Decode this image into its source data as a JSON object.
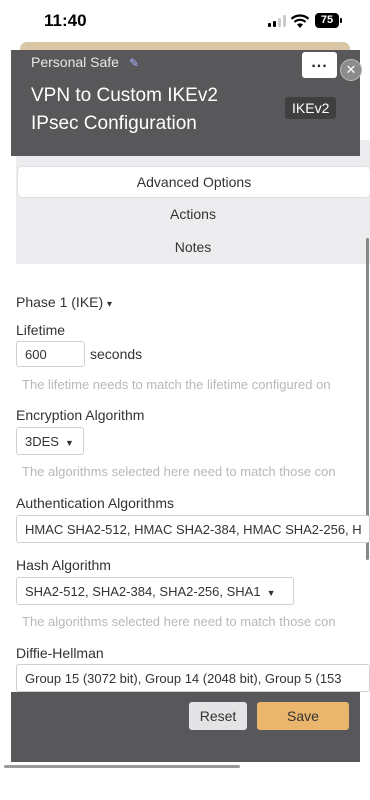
{
  "status_bar": {
    "time": "11:40",
    "battery": "75"
  },
  "header": {
    "section": "Personal Safe",
    "title_line1": "VPN to Custom IKEv2",
    "title_line2_bold": "IPsec",
    "title_line2_rest": " Configuration",
    "badge": "IKEv2",
    "more_label": "...",
    "close_label": "✕"
  },
  "tabs": [
    {
      "label": "Advanced Options",
      "active": true
    },
    {
      "label": "Actions",
      "active": false
    },
    {
      "label": "Notes",
      "active": false
    }
  ],
  "phase1": {
    "label": "Phase 1 (IKE)",
    "caret": "▾"
  },
  "lifetime": {
    "label": "Lifetime",
    "value": "600",
    "unit": "seconds",
    "hint": "The lifetime needs to match the lifetime configured on"
  },
  "encryption": {
    "label": "Encryption Algorithm",
    "value": "3DES",
    "hint": "The algorithms selected here need to match those con"
  },
  "authentication": {
    "label": "Authentication Algorithms",
    "value": "HMAC SHA2-512, HMAC SHA2-384, HMAC SHA2-256, H"
  },
  "hash": {
    "label": "Hash Algorithm",
    "value": "SHA2-512, SHA2-384, SHA2-256, SHA1",
    "hint": "The algorithms selected here need to match those con"
  },
  "dh": {
    "label": "Diffie-Hellman",
    "value": "Group 15 (3072 bit), Group 14 (2048 bit), Group 5 (153"
  },
  "footer": {
    "reset": "Reset",
    "save": "Save"
  },
  "colors": {
    "accent": "#eab56d",
    "header_bg": "#58585a"
  }
}
